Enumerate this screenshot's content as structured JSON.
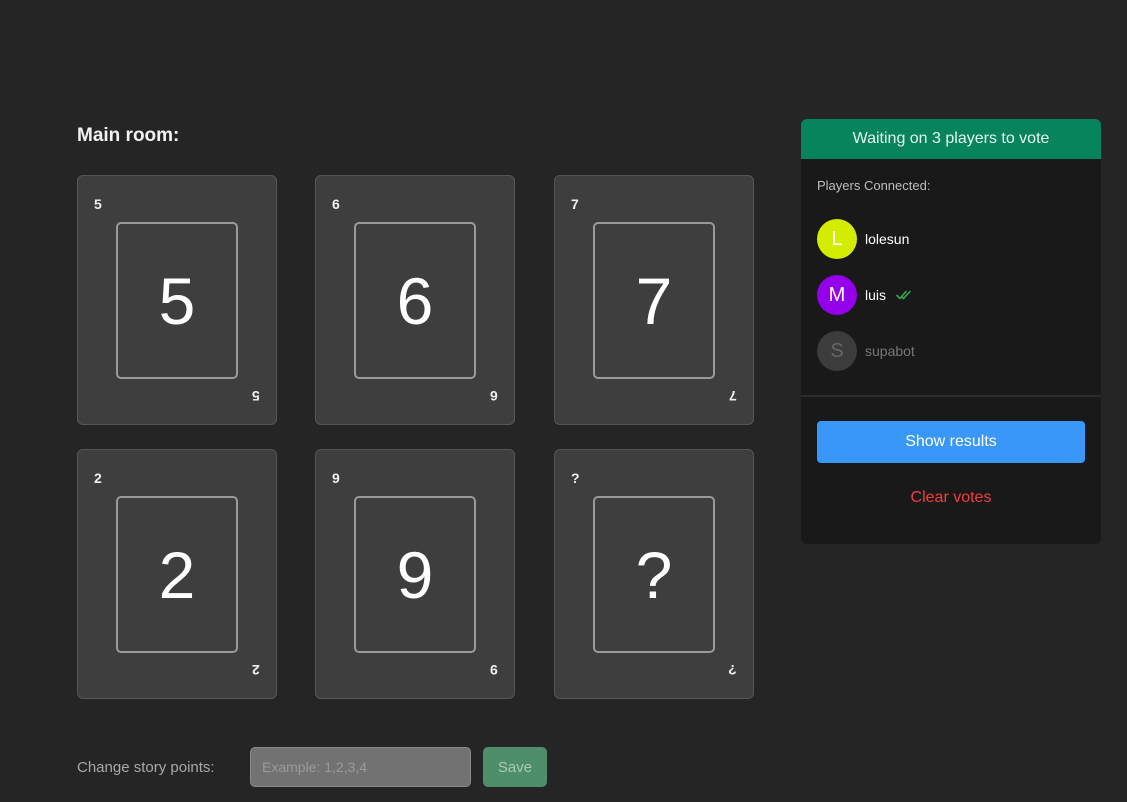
{
  "room": {
    "title": "Main room:"
  },
  "cards": [
    {
      "value": "5"
    },
    {
      "value": "6"
    },
    {
      "value": "7"
    },
    {
      "value": "2"
    },
    {
      "value": "9"
    },
    {
      "value": "?"
    }
  ],
  "panel": {
    "header": "Waiting on 3 players to vote",
    "players_label": "Players Connected:",
    "players": [
      {
        "initial": "L",
        "name": "lolesun",
        "color": "#d4ec00",
        "voted": false,
        "online": true
      },
      {
        "initial": "M",
        "name": "luis",
        "color": "#9400ea",
        "voted": true,
        "online": true
      },
      {
        "initial": "S",
        "name": "supabot",
        "color": "#3c3c3c",
        "voted": false,
        "online": false
      }
    ],
    "show_results": "Show results",
    "clear_votes": "Clear votes"
  },
  "story": {
    "label": "Change story points:",
    "placeholder": "Example: 1,2,3,4",
    "save": "Save"
  },
  "colors": {
    "accent_green": "#07845c",
    "accent_blue": "#3897f7",
    "danger": "#f23e3e",
    "check": "#2fa84f"
  }
}
